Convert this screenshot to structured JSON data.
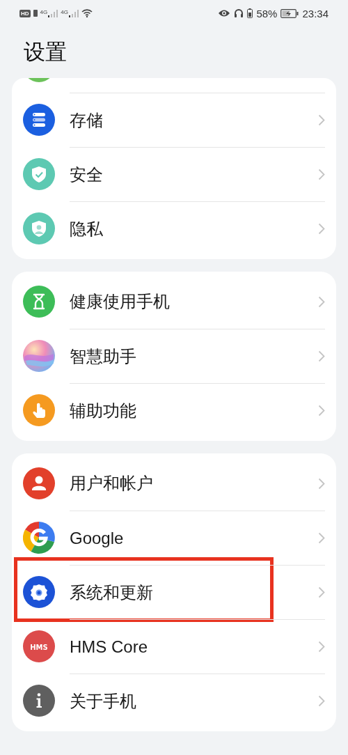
{
  "status_bar": {
    "hd": "HD",
    "network_1": "4G",
    "network_2": "4G",
    "battery_percent": "58%",
    "time": "23:34"
  },
  "title": "设置",
  "groups": [
    {
      "scrolled_top": true,
      "items": [
        {
          "label": "存储",
          "highlighted": false
        },
        {
          "label": "安全",
          "highlighted": false
        },
        {
          "label": "隐私",
          "highlighted": false
        }
      ]
    },
    {
      "scrolled_top": false,
      "items": [
        {
          "label": "健康使用手机",
          "highlighted": false
        },
        {
          "label": "智慧助手",
          "highlighted": false
        },
        {
          "label": "辅助功能",
          "highlighted": false
        }
      ]
    },
    {
      "scrolled_top": false,
      "items": [
        {
          "label": "用户和帐户",
          "highlighted": false
        },
        {
          "label": "Google",
          "highlighted": false
        },
        {
          "label": "系统和更新",
          "highlighted": true
        },
        {
          "label": "HMS Core",
          "highlighted": false,
          "icon_text": "HMS"
        },
        {
          "label": "关于手机",
          "highlighted": false
        }
      ]
    }
  ]
}
